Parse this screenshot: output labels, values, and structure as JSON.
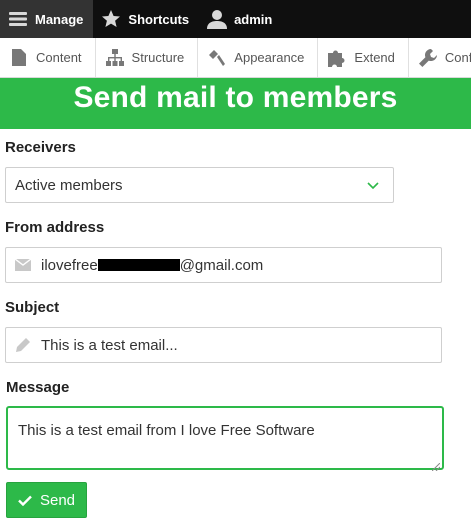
{
  "toolbar": {
    "items": [
      {
        "label": "Manage",
        "icon": "menu-icon"
      },
      {
        "label": "Shortcuts",
        "icon": "star-icon"
      },
      {
        "label": "admin",
        "icon": "user-icon"
      }
    ]
  },
  "tray": {
    "items": [
      {
        "label": "Content",
        "icon": "document-icon"
      },
      {
        "label": "Structure",
        "icon": "structure-icon"
      },
      {
        "label": "Appearance",
        "icon": "paintbrush-icon"
      },
      {
        "label": "Extend",
        "icon": "puzzle-icon"
      },
      {
        "label": "Configuration",
        "icon": "wrench-icon"
      }
    ]
  },
  "page": {
    "title": "Send mail to members",
    "accent_color": "#2db949"
  },
  "form": {
    "receivers_label": "Receivers",
    "receivers_value": "Active members",
    "from_label": "From address",
    "from_value_prefix": "ilovefree",
    "from_value_suffix": "@gmail.com",
    "subject_label": "Subject",
    "subject_value": "This is a test email...",
    "message_label": "Message",
    "message_value": "This is a test email from I love Free Software",
    "send_label": "Send"
  }
}
